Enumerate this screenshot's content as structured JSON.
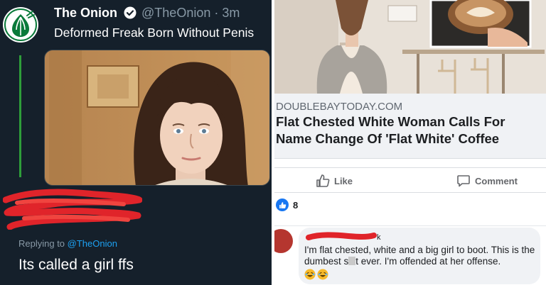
{
  "tweet": {
    "account_name": "The Onion",
    "handle": "@TheOnion",
    "time": "· 3m",
    "text": "Deformed Freak Born Without Penis",
    "verified": true
  },
  "reply": {
    "replying_label": "Replying to",
    "mention": "@TheOnion",
    "text": "Its called a girl ffs"
  },
  "facebook": {
    "link_domain": "DOUBLEBAYTODAY.COM",
    "link_title": "Flat Chested White Woman Calls For Name Change Of 'Flat White' Coffee",
    "like_label": "Like",
    "comment_label": "Comment",
    "reaction_count": "8",
    "comment": {
      "text_part1": "I'm flat chested, white and a big girl to boot. This is the dumbest s",
      "text_part2": "t ever. I'm offended at her offense."
    }
  },
  "colors": {
    "twitter_bg": "#15202b",
    "twitter_link": "#1da1f2",
    "fb_blue": "#1877f2",
    "onion_green": "#0a7a3a",
    "redaction_red": "#e0242a"
  },
  "icons": [
    "onion-logo-icon",
    "verified-badge-icon",
    "thumbs-up-icon",
    "comment-icon",
    "like-reaction-icon",
    "laughing-emoji-icon"
  ]
}
